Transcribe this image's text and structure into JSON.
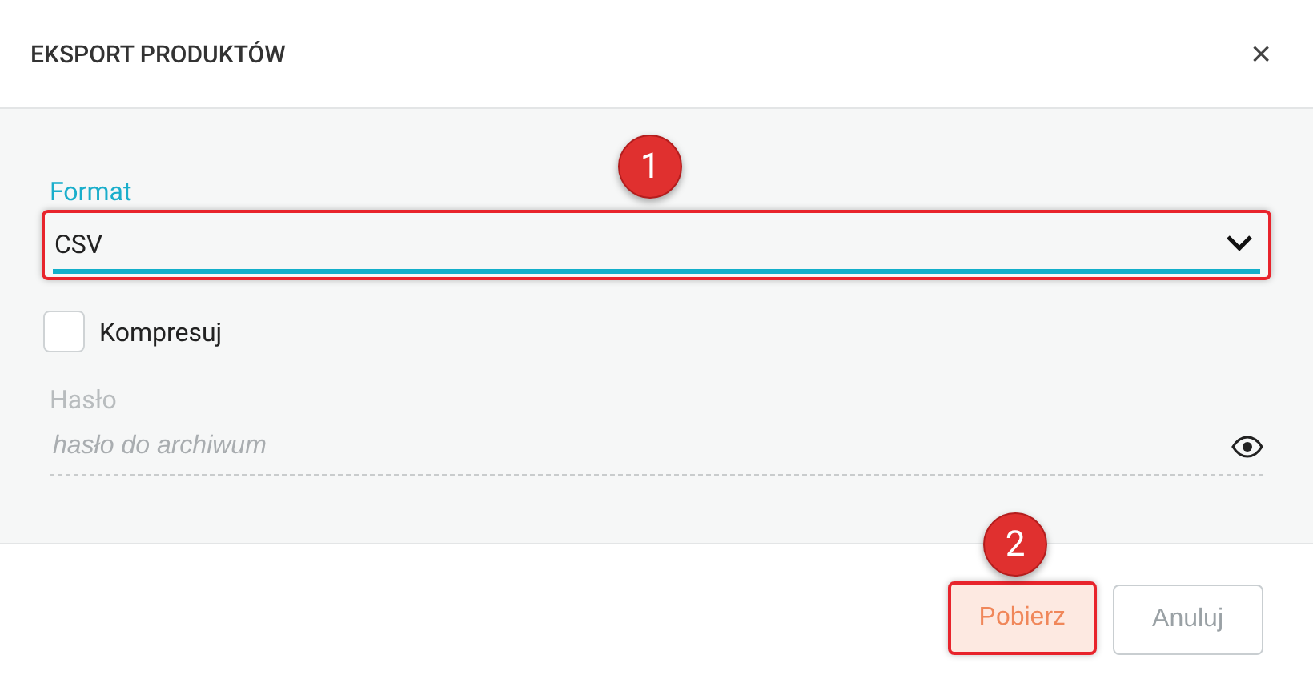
{
  "dialog": {
    "title": "EKSPORT PRODUKTÓW",
    "close": "×"
  },
  "format": {
    "label": "Format",
    "value": "CSV",
    "highlighted": true
  },
  "compress": {
    "label": "Kompresuj",
    "checked": false
  },
  "password": {
    "label": "Hasło",
    "placeholder": "hasło do archiwum"
  },
  "buttons": [
    {
      "label": "Pobierz",
      "kind": "primary",
      "highlighted": true
    },
    {
      "label": "Anuluj",
      "kind": "secondary",
      "highlighted": false
    }
  ],
  "annotations": [
    {
      "number": "1"
    },
    {
      "number": "2"
    }
  ]
}
